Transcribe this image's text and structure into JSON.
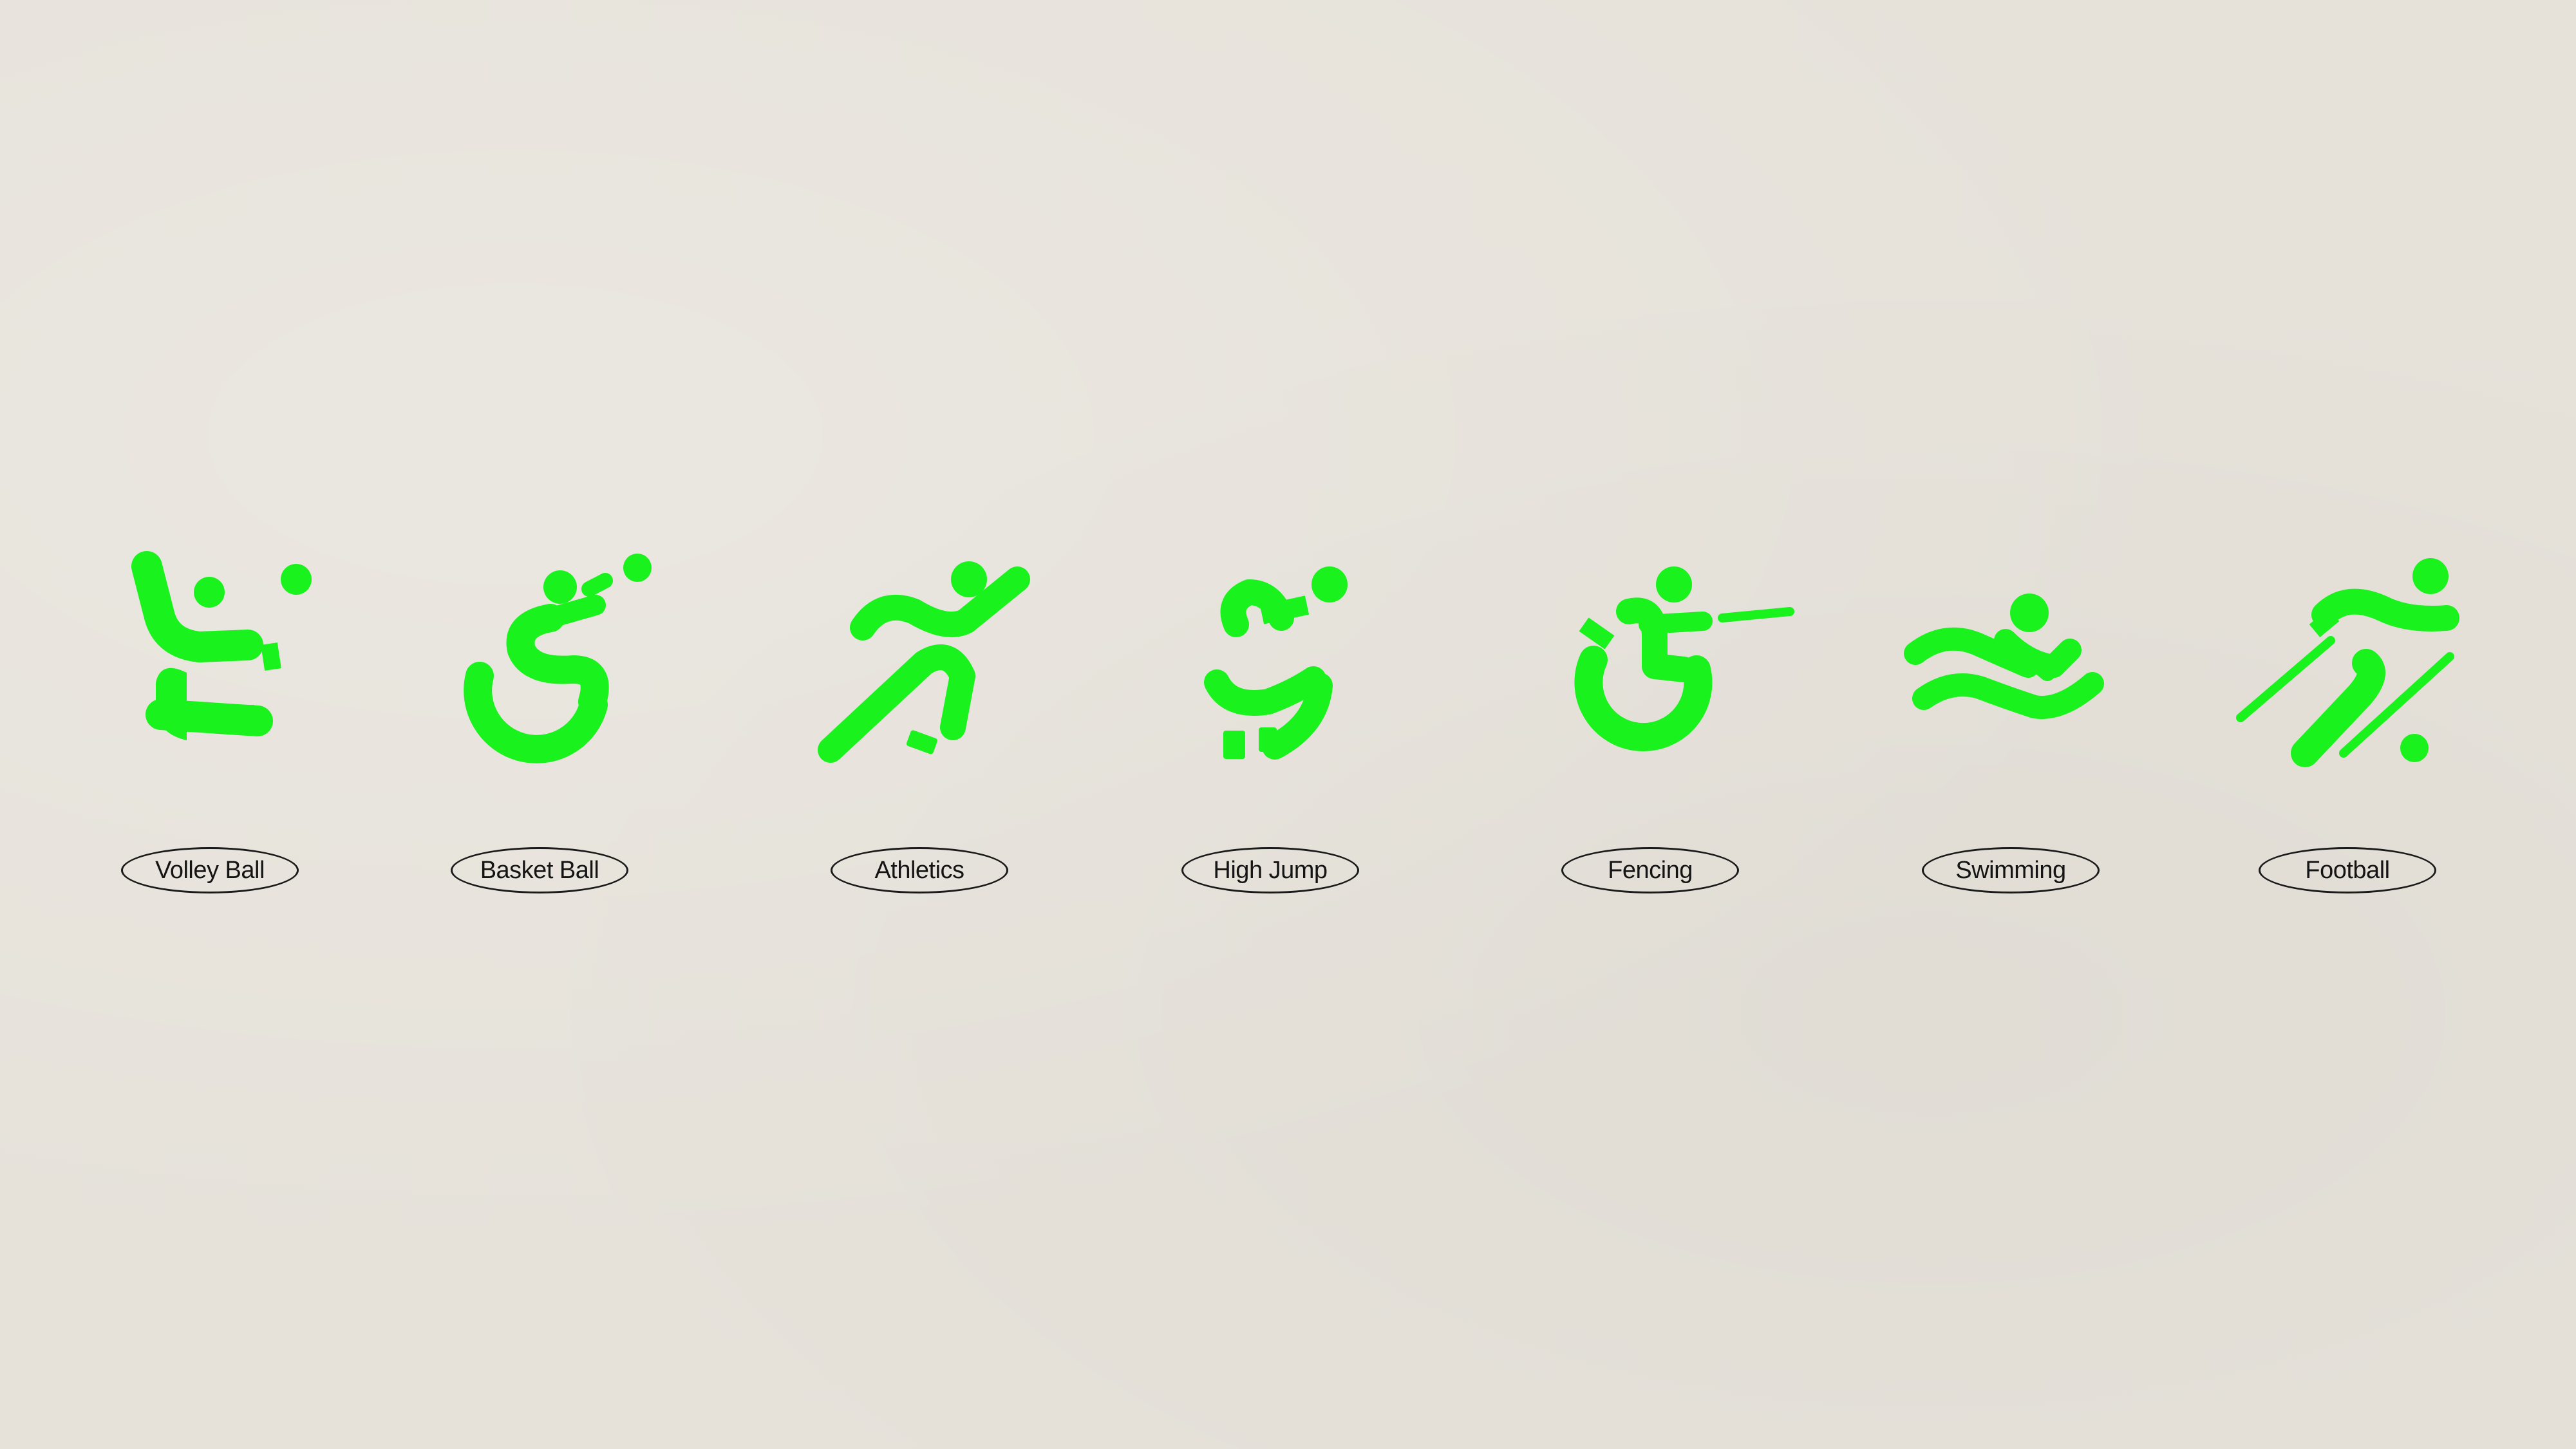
{
  "accent_color": "#19f21c",
  "label_color": "#141414",
  "background_color": "#e6e2da",
  "sports": [
    {
      "label": "Volley Ball",
      "icon": "volleyball-pictogram-icon"
    },
    {
      "label": "Basket Ball",
      "icon": "wheelchair-basketball-pictogram-icon"
    },
    {
      "label": "Athletics",
      "icon": "athletics-runner-pictogram-icon"
    },
    {
      "label": "High Jump",
      "icon": "high-jump-pictogram-icon"
    },
    {
      "label": "Fencing",
      "icon": "wheelchair-fencing-pictogram-icon"
    },
    {
      "label": "Swimming",
      "icon": "swimming-pictogram-icon"
    },
    {
      "label": "Football",
      "icon": "blind-football-pictogram-icon"
    }
  ]
}
